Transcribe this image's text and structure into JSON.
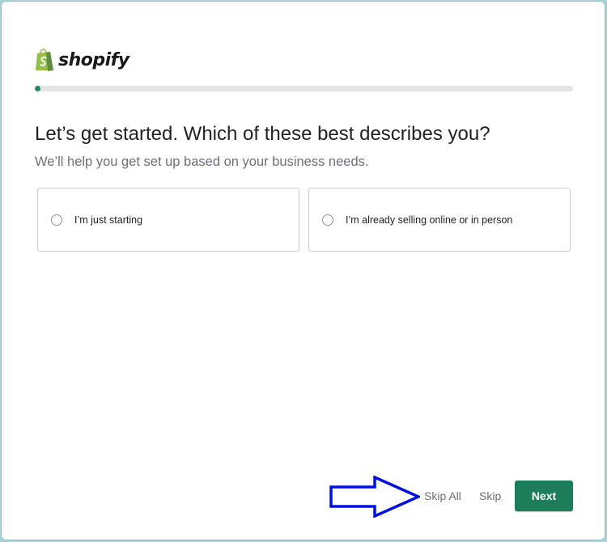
{
  "brand": {
    "logo_text": "shopify",
    "logo_icon": "shopify-bag-icon",
    "color": "#95bf47"
  },
  "progress": {
    "fraction": 0.01,
    "color": "#1f8a5c"
  },
  "question": {
    "title": "Let’s get started. Which of these best describes you?",
    "subtitle": "We’ll help you get set up based on your business needs."
  },
  "options": [
    {
      "label": "I’m just starting",
      "selected": false
    },
    {
      "label": "I’m already selling online or in person",
      "selected": false
    }
  ],
  "annotation": {
    "icon": "blue-arrow-icon",
    "color": "#0010e0"
  },
  "footer": {
    "skip_all_label": "Skip All",
    "skip_label": "Skip",
    "next_label": "Next",
    "next_color": "#1e7d5a"
  }
}
